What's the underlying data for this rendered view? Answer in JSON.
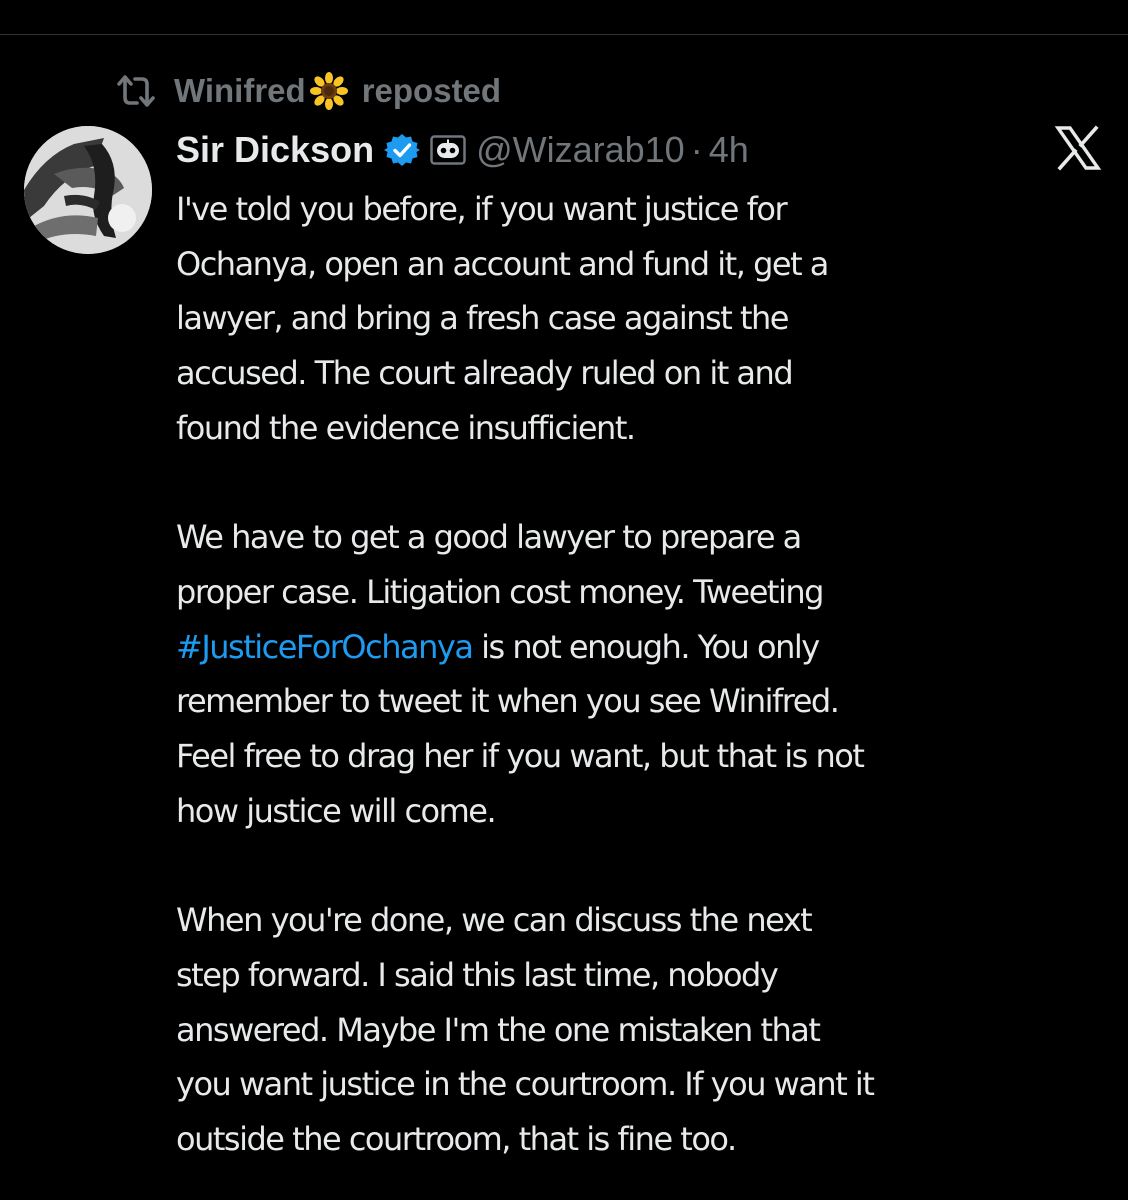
{
  "repost": {
    "reposter_name": "Winifred",
    "reposter_emoji": "sunflower",
    "action_label": "reposted"
  },
  "author": {
    "display_name": "Sir Dickson",
    "verified": true,
    "automated": true,
    "handle": "@Wizarab10",
    "separator": "·",
    "time_ago": "4h"
  },
  "icons": {
    "repost": "repost-icon",
    "verified": "verified-badge-icon",
    "automated": "automated-account-icon",
    "brand": "x-logo-icon"
  },
  "colors": {
    "background": "#000000",
    "text": "#e7e9ea",
    "secondary_text": "#71767b",
    "link": "#1d9bf0",
    "verified": "#1d9bf0"
  },
  "tweet": {
    "p1": [
      "I've told you before, if you want justice for",
      "Ochanya, open an account and fund it, get a",
      "lawyer, and bring a fresh case against the",
      "accused. The court already ruled on it and",
      "found the evidence insufficient."
    ],
    "p2": [
      "We have to get a good lawyer to prepare a",
      "proper case. Litigation cost money. Tweeting"
    ],
    "hashtag": "#JusticeForOchanya",
    "p2_after_hashtag": " is not enough. You only",
    "p2_rest": [
      "remember to tweet it when you see Winifred.",
      "Feel free to drag her if you want, but that is not",
      "how justice will come."
    ],
    "p3": [
      "When you're done, we can discuss the next",
      "step forward. I said this last time, nobody",
      "answered. Maybe I'm the one mistaken that",
      "you want justice in the courtroom. If you want it",
      "outside the courtroom, that is fine too."
    ]
  }
}
